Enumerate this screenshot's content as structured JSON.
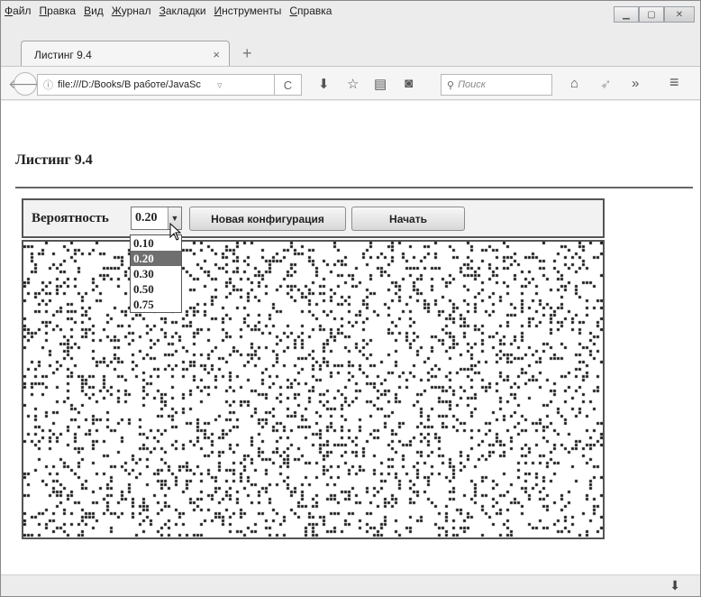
{
  "menu": [
    "Файл",
    "Правка",
    "Вид",
    "Журнал",
    "Закладки",
    "Инструменты",
    "Справка"
  ],
  "menu_access": [
    "Ф",
    "П",
    "В",
    "Ж",
    "З",
    "И",
    "С"
  ],
  "tab": {
    "title": "Листинг 9.4",
    "close": "×",
    "new": "+"
  },
  "nav": {
    "url": "file:///D:/Books/В работе/JavaSc",
    "reload": "C",
    "search_placeholder": "Поиск",
    "more": "»",
    "menu": "≡"
  },
  "page": {
    "title": "Листинг 9.4",
    "prob_label": "Вероятность",
    "selected": "0.20",
    "options": [
      "0.10",
      "0.20",
      "0.30",
      "0.50",
      "0.75"
    ],
    "btn_new": "Новая конфигурация",
    "btn_start": "Начать"
  },
  "grid": {
    "probability": 0.2,
    "color_alive": "#1a1a1a",
    "color_dead": "#ffffff"
  },
  "status": {
    "download": "⬇"
  }
}
